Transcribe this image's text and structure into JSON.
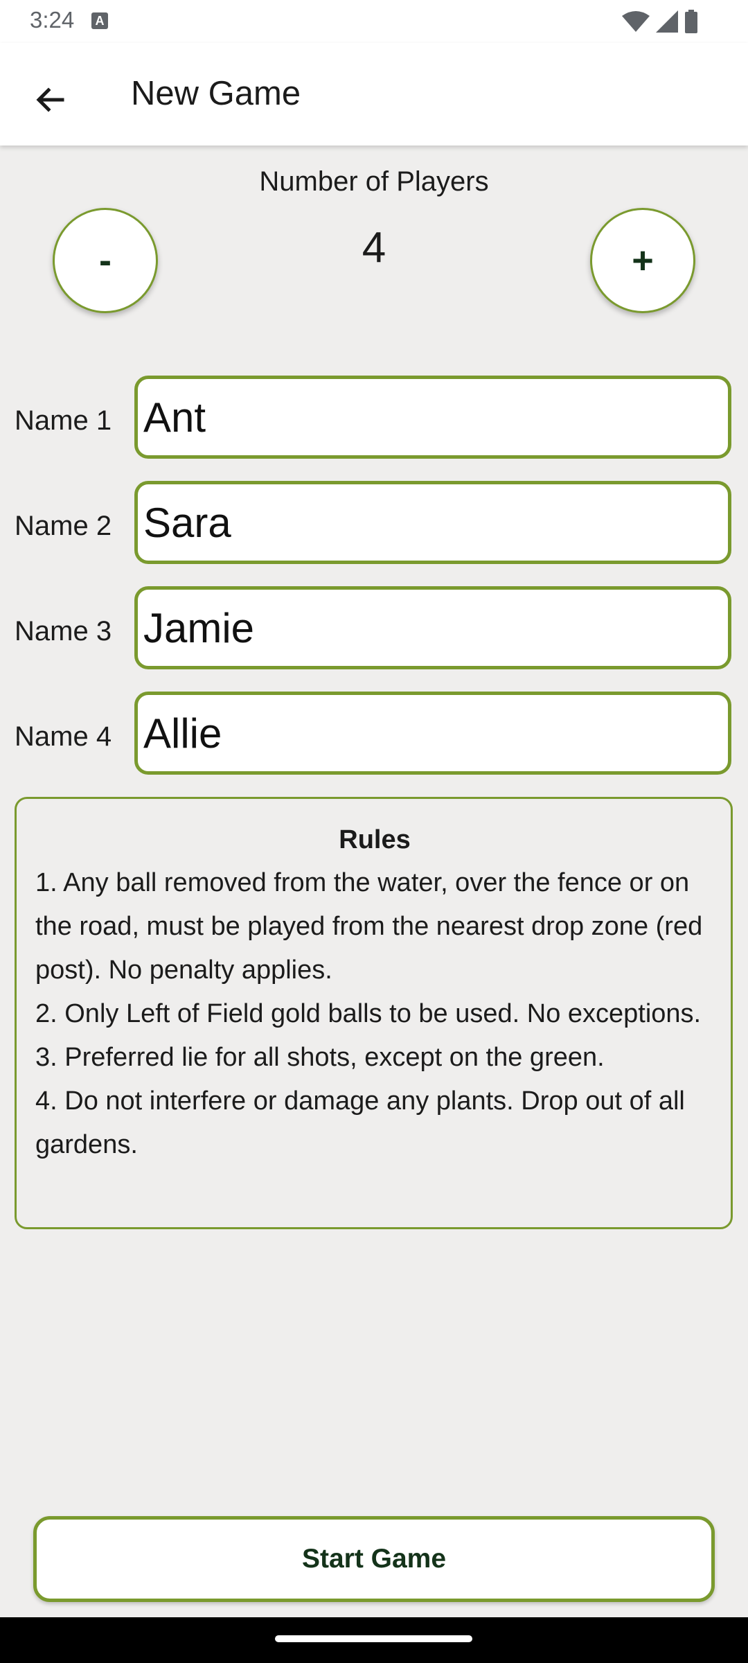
{
  "status_bar": {
    "time": "3:24",
    "icons": [
      "text-a-icon",
      "wifi-icon",
      "signal-icon",
      "battery-icon"
    ]
  },
  "app_bar": {
    "back_icon": "arrow-back-icon",
    "title": "New Game"
  },
  "players": {
    "label": "Number of Players",
    "decrement_label": "-",
    "increment_label": "+",
    "count": "4"
  },
  "names": [
    {
      "label": "Name 1",
      "value": "Ant"
    },
    {
      "label": "Name 2",
      "value": "Sara"
    },
    {
      "label": "Name 3",
      "value": "Jamie"
    },
    {
      "label": "Name 4",
      "value": "Allie"
    }
  ],
  "rules": {
    "title": "Rules",
    "items": [
      "1. Any ball removed from the water, over the fence or on the road, must be played from the nearest drop zone (red post). No penalty applies.",
      "2. Only Left of Field gold balls to be used. No exceptions.",
      "3. Preferred lie for all shots, except on the green.",
      "4. Do not interfere or damage any plants. Drop out of all gardens."
    ]
  },
  "start_button": {
    "label": "Start Game"
  },
  "colors": {
    "accent_border": "#7a9a2e",
    "button_text": "#14331a",
    "background": "#efeeed"
  }
}
